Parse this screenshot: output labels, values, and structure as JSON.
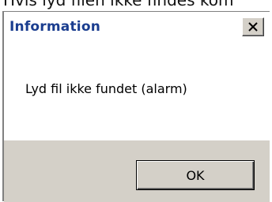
{
  "background_caption": "Hvis lyd filen ikke findes kom",
  "dialog": {
    "title": "Information",
    "close_icon": "close-x-icon",
    "message": "Lyd fil ikke fundet (alarm)",
    "ok_label": "OK"
  },
  "colors": {
    "title_text": "#1a3d8f",
    "dialog_face": "#d4d0c8",
    "content_background": "#ffffff"
  }
}
